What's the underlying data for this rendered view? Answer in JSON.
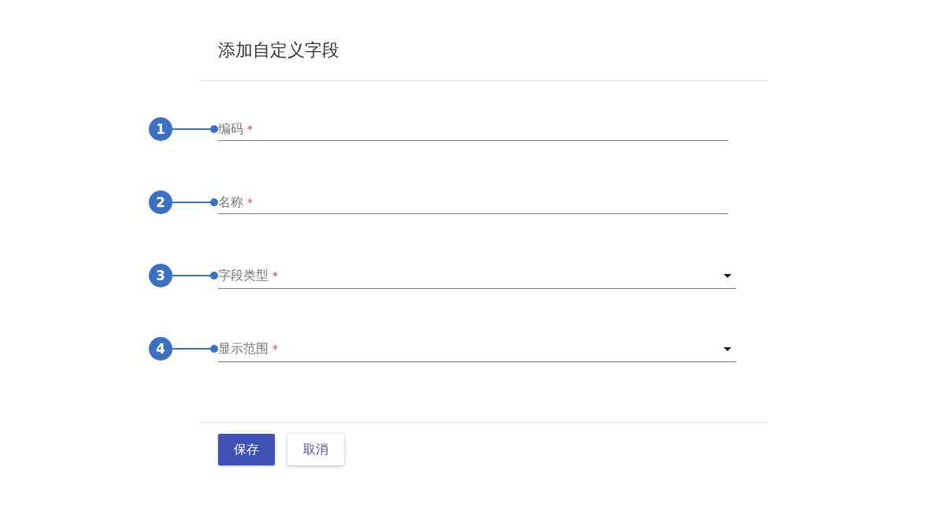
{
  "title": "添加自定义字段",
  "fields": [
    {
      "kind": "text",
      "callout": "1",
      "label": "编码",
      "required_mark": "*"
    },
    {
      "kind": "text",
      "callout": "2",
      "label": "名称",
      "required_mark": "*"
    },
    {
      "kind": "select",
      "callout": "3",
      "label": "字段类型",
      "required_mark": "*"
    },
    {
      "kind": "select",
      "callout": "4",
      "label": "显示范围",
      "required_mark": "*"
    }
  ],
  "buttons": [
    {
      "kind": "primary",
      "label": "保存"
    },
    {
      "kind": "secondary",
      "label": "取消"
    }
  ]
}
